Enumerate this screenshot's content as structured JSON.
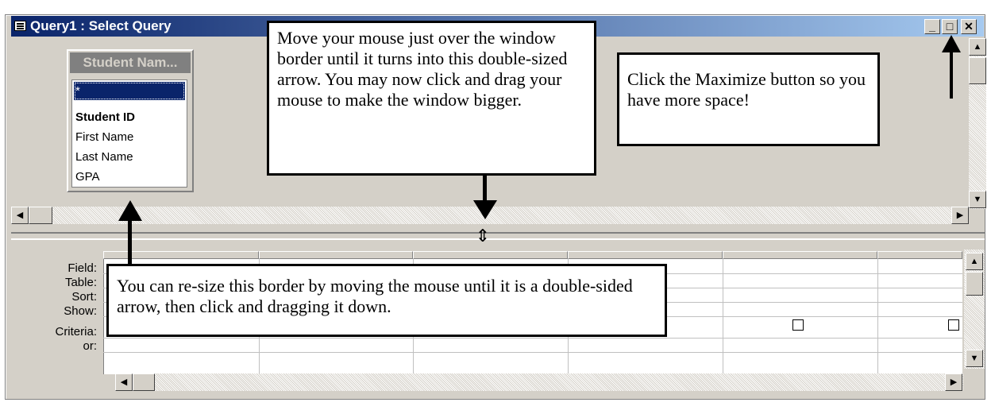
{
  "window": {
    "title": "Query1 : Select Query",
    "buttons": {
      "minimize": "_",
      "maximize": "□",
      "close": "✕"
    }
  },
  "field_list": {
    "title": "Student Nam...",
    "items": [
      "*",
      "Student ID",
      "First Name",
      "Last Name",
      "GPA"
    ]
  },
  "grid": {
    "row_labels": [
      "Field:",
      "Table:",
      "Sort:",
      "Show:",
      "Criteria:",
      "or:"
    ]
  },
  "callouts": {
    "resize_window": "Move your mouse just over the window border until it turns into this double-sized arrow.  You may now click and drag your mouse to make the window bigger.",
    "maximize": "Click the Maximize button so you have more space!",
    "resize_border": "You can re-size this border by moving the mouse until it is a double-sided arrow, then click and dragging it down."
  },
  "icons": {
    "resize_cursor": "⇕",
    "scroll_up": "▲",
    "scroll_down": "▼",
    "scroll_left": "◀",
    "scroll_right": "▶"
  }
}
